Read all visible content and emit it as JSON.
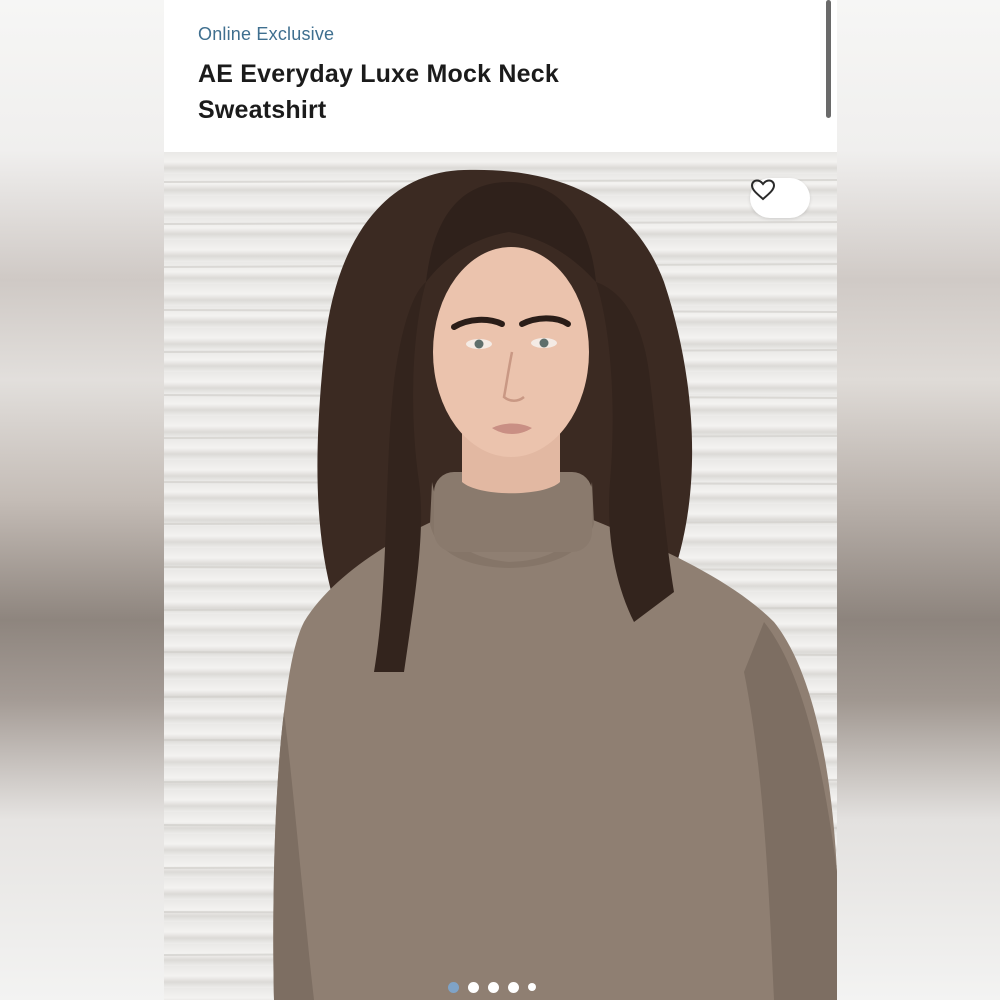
{
  "product": {
    "badge": "Online Exclusive",
    "title": "AE Everyday Luxe Mock Neck Sweatshirt"
  },
  "gallery": {
    "image_alt": "Model wearing taupe mock neck sweatshirt",
    "favorite_icon": "heart-outline-icon",
    "slide_count": 5,
    "active_slide": 1
  },
  "colors": {
    "badge": "#3f6f8f",
    "active_dot": "#7fa3c7",
    "sweatshirt": "#8f7f72"
  }
}
